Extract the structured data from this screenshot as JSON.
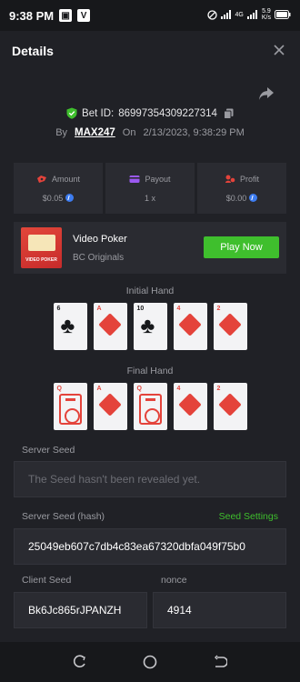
{
  "status_bar": {
    "time": "9:38 PM",
    "net_speed_value": "5.9",
    "net_speed_unit": "K/s",
    "network_label": "4G"
  },
  "header": {
    "title": "Details"
  },
  "bet": {
    "id_label": "Bet ID:",
    "id": "86997354309227314",
    "by_label": "By",
    "user": "MAX247",
    "on_label": "On",
    "datetime": "2/13/2023, 9:38:29 PM"
  },
  "stats": {
    "amount": {
      "label": "Amount",
      "value": "$0.05"
    },
    "payout": {
      "label": "Payout",
      "value": "1 x"
    },
    "profit": {
      "label": "Profit",
      "value": "$0.00"
    }
  },
  "game": {
    "name": "Video Poker",
    "provider": "BC Originals",
    "thumb_label": "VIDEO POKER",
    "play_label": "Play Now"
  },
  "hands": {
    "initial_label": "Initial Hand",
    "final_label": "Final Hand",
    "initial": [
      {
        "rank": "6",
        "suit": "club"
      },
      {
        "rank": "A",
        "suit": "diamond"
      },
      {
        "rank": "10",
        "suit": "club"
      },
      {
        "rank": "4",
        "suit": "diamond"
      },
      {
        "rank": "2",
        "suit": "diamond"
      }
    ],
    "final": [
      {
        "rank": "Q",
        "suit": "heart"
      },
      {
        "rank": "A",
        "suit": "diamond"
      },
      {
        "rank": "Q",
        "suit": "heart"
      },
      {
        "rank": "4",
        "suit": "diamond"
      },
      {
        "rank": "2",
        "suit": "diamond"
      }
    ]
  },
  "seeds": {
    "server_seed_label": "Server Seed",
    "server_seed_placeholder": "The Seed hasn't been revealed yet.",
    "server_hash_label": "Server Seed (hash)",
    "seed_settings_label": "Seed Settings",
    "server_hash": "25049eb607c7db4c83ea67320dbfa049f75b0",
    "client_seed_label": "Client Seed",
    "client_seed": "Bk6Jc865rJPANZH",
    "nonce_label": "nonce",
    "nonce": "4914"
  },
  "colors": {
    "background": "#17181b",
    "panel": "#202126",
    "card": "#2a2b31",
    "accent_green": "#3fbf2d",
    "muted_text": "#9a9ba1",
    "suit_red": "#e4433b"
  }
}
